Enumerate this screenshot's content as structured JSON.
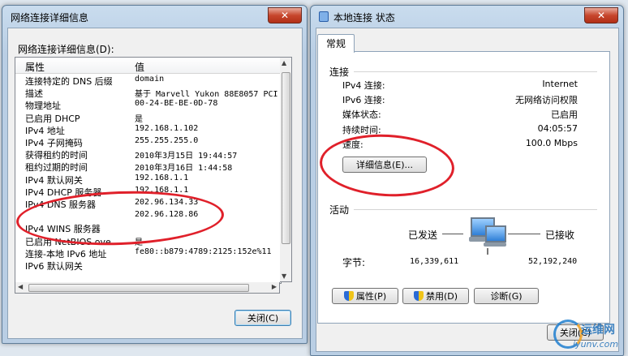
{
  "left_window": {
    "title": "网络连接详细信息",
    "close_glyph": "✕",
    "list_label": "网络连接详细信息(D):",
    "columns": {
      "property": "属性",
      "value": "值"
    },
    "rows": [
      {
        "property": "连接特定的 DNS 后缀",
        "value": "domain"
      },
      {
        "property": "描述",
        "value": "基于 Marvell Yukon 88E8057 PCI"
      },
      {
        "property": "物理地址",
        "value": "00-24-BE-BE-0D-78"
      },
      {
        "property": "已启用 DHCP",
        "value": "是"
      },
      {
        "property": "IPv4 地址",
        "value": "192.168.1.102"
      },
      {
        "property": "IPv4 子网掩码",
        "value": "255.255.255.0"
      },
      {
        "property": "获得租约的时间",
        "value": "2010年3月15日 19:44:57"
      },
      {
        "property": "租约过期的时间",
        "value": "2010年3月16日 1:44:58"
      },
      {
        "property": "IPv4 默认网关",
        "value": "192.168.1.1"
      },
      {
        "property": "IPv4 DHCP 服务器",
        "value": "192.168.1.1"
      },
      {
        "property": "IPv4 DNS 服务器",
        "value": "202.96.134.33"
      },
      {
        "property": "",
        "value": "202.96.128.86"
      },
      {
        "property": "IPv4 WINS 服务器",
        "value": ""
      },
      {
        "property": "已启用 NetBIOS ove...",
        "value": "是"
      },
      {
        "property": "连接-本地 IPv6 地址",
        "value": "fe80::b879:4789:2125:152e%11"
      },
      {
        "property": "IPv6 默认网关",
        "value": ""
      }
    ],
    "close_button": "关闭(C)"
  },
  "right_window": {
    "title": "本地连接 状态",
    "close_glyph": "✕",
    "tab": "常规",
    "connection_group": "连接",
    "connection": [
      {
        "label": "IPv4 连接:",
        "value": "Internet"
      },
      {
        "label": "IPv6 连接:",
        "value": "无网络访问权限"
      },
      {
        "label": "媒体状态:",
        "value": "已启用"
      },
      {
        "label": "持续时间:",
        "value": "04:05:57"
      },
      {
        "label": "速度:",
        "value": "100.0 Mbps"
      }
    ],
    "details_button": "详细信息(E)...",
    "activity_group": "活动",
    "sent_label": "已发送",
    "received_label": "已接收",
    "bytes_label": "字节:",
    "bytes_sent": "16,339,611",
    "bytes_received": "52,192,240",
    "properties_button": "属性(P)",
    "disable_button": "禁用(D)",
    "diagnose_button": "诊断(G)",
    "close_button": "关闭(C)"
  },
  "watermark": {
    "text1": "运维网",
    "text2": "iyunv.com"
  },
  "colors": {
    "annotation_red": "#e0202a",
    "title_close": "#c7462d"
  }
}
